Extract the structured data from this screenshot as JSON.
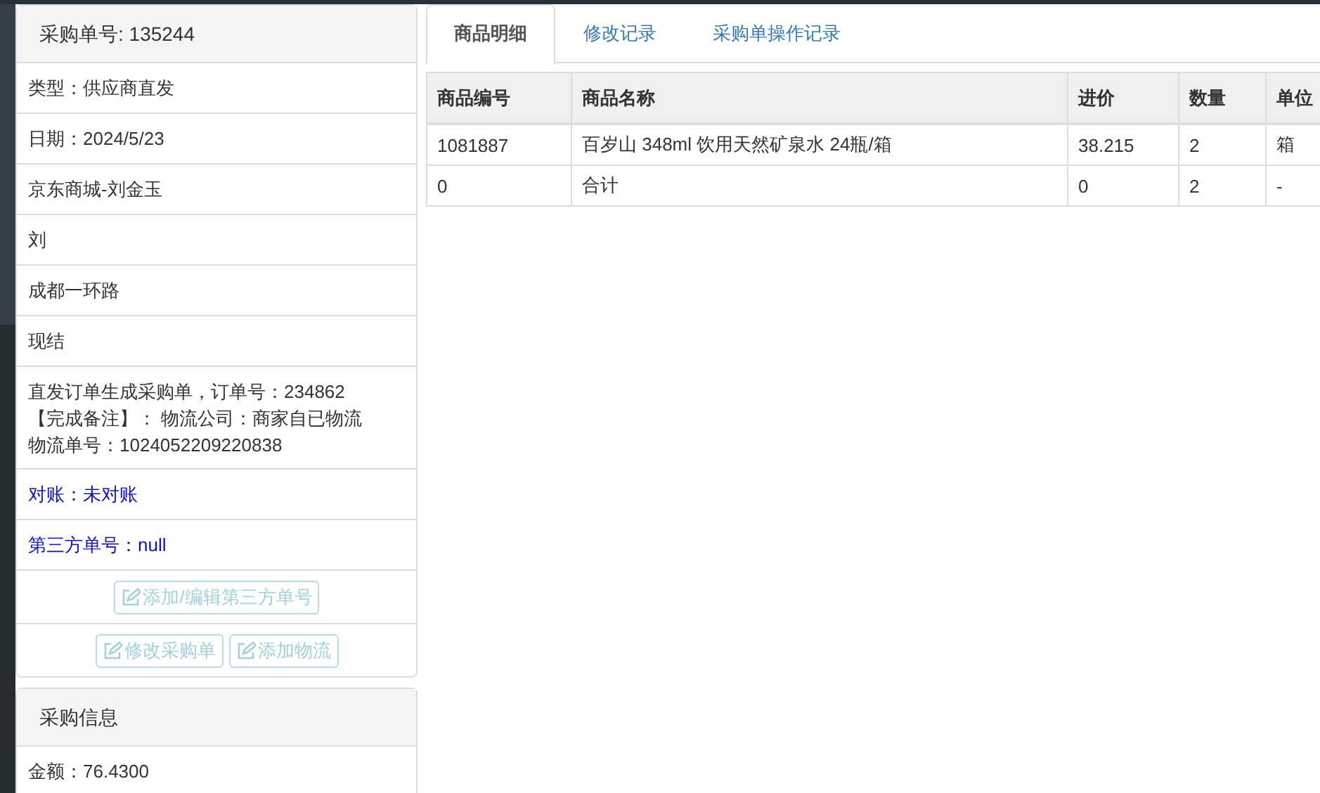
{
  "order_panel": {
    "title": "采购单号: 135244",
    "rows": [
      {
        "kind": "text",
        "text": "类型：供应商直发"
      },
      {
        "kind": "text",
        "text": "日期：2024/5/23"
      },
      {
        "kind": "text",
        "text": "京东商城-刘金玉"
      },
      {
        "kind": "text",
        "text": "刘"
      },
      {
        "kind": "text",
        "text": "成都一环路"
      },
      {
        "kind": "text",
        "text": "现结"
      },
      {
        "kind": "lines",
        "lines": [
          "直发订单生成采购单，订单号：234862",
          "【完成备注】： 物流公司：商家自已物流",
          "物流单号：1024052209220838"
        ]
      },
      {
        "kind": "link",
        "text": "对账：未对账"
      },
      {
        "kind": "link",
        "text": "第三方单号：null"
      }
    ],
    "button_rows": [
      [
        {
          "label": "添加/编辑第三方单号",
          "disabled": true
        }
      ],
      [
        {
          "label": "修改采购单",
          "disabled": true
        },
        {
          "label": "添加物流",
          "disabled": true
        }
      ]
    ]
  },
  "purchase_panel": {
    "title": "采购信息",
    "rows": [
      {
        "kind": "text",
        "text": "金额：76.4300"
      }
    ]
  },
  "tabs": [
    {
      "label": "商品明细",
      "selected": true
    },
    {
      "label": "修改记录",
      "selected": false
    },
    {
      "label": "采购单操作记录",
      "selected": false
    }
  ],
  "table": {
    "columns": [
      "商品编号",
      "商品名称",
      "进价",
      "数量",
      "单位"
    ],
    "rows": [
      [
        "1081887",
        "百岁山 348ml 饮用天然矿泉水 24瓶/箱",
        "38.215",
        "2",
        "箱"
      ],
      [
        "0",
        "合计",
        "0",
        "2",
        "-"
      ]
    ]
  }
}
